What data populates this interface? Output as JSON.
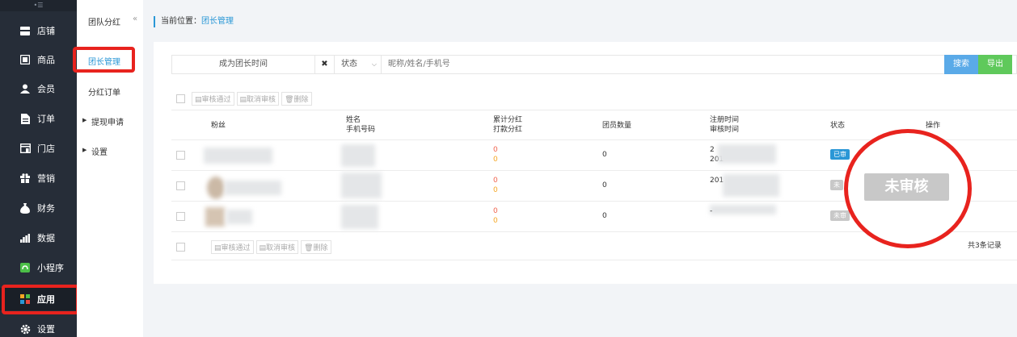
{
  "nav": {
    "items": [
      {
        "label": "店铺",
        "icon": "store-icon"
      },
      {
        "label": "商品",
        "icon": "goods-icon"
      },
      {
        "label": "会员",
        "icon": "user-icon"
      },
      {
        "label": "订单",
        "icon": "order-icon"
      },
      {
        "label": "门店",
        "icon": "shop-icon"
      },
      {
        "label": "营销",
        "icon": "gift-icon"
      },
      {
        "label": "财务",
        "icon": "money-bag-icon"
      },
      {
        "label": "数据",
        "icon": "bar-chart-icon"
      },
      {
        "label": "小程序",
        "icon": "mini-program-icon"
      },
      {
        "label": "应用",
        "icon": "apps-icon"
      },
      {
        "label": "设置",
        "icon": "gear-icon"
      }
    ]
  },
  "subnav": {
    "title": "团队分红",
    "collapse": "«",
    "items": [
      "团长管理",
      "分红订单",
      "提现申请",
      "设置"
    ]
  },
  "breadcrumb": {
    "prefix": "当前位置：",
    "current": "团长管理"
  },
  "filter": {
    "time_label": "成为团长时间",
    "clear": "✖",
    "state_label": "状态",
    "keyword_placeholder": "昵称/姓名/手机号",
    "search_label": "搜索",
    "export_label": "导出"
  },
  "bulk": {
    "approve": "审核通过",
    "cancel": "取消审核",
    "delete": "删除"
  },
  "table": {
    "headers": {
      "fans": "粉丝",
      "name": "姓名",
      "phone": "手机号码",
      "total_bonus": "累计分红",
      "paid_bonus": "打款分红",
      "members": "团员数量",
      "reg_time": "注册时间",
      "audit_time": "审核时间",
      "status": "状态",
      "ops": "操作"
    },
    "rows": [
      {
        "total_bonus": "0",
        "paid_bonus": "0",
        "members": "0",
        "date_a": "2",
        "date_b": "201",
        "status": "已审"
      },
      {
        "total_bonus": "0",
        "paid_bonus": "0",
        "members": "0",
        "date_a": "201",
        "date_b": "",
        "status": "未"
      },
      {
        "total_bonus": "0",
        "paid_bonus": "0",
        "members": "0",
        "date_a": "",
        "date_b": "-",
        "status": "未审"
      }
    ],
    "total_text": "共3条记录"
  },
  "callout": {
    "label": "未审核"
  },
  "colors": {
    "accent": "#2a97d6",
    "highlight": "#e8231e",
    "sidebar": "#262d38",
    "approved": "#2a97d6",
    "pending": "#c8c8c8"
  }
}
